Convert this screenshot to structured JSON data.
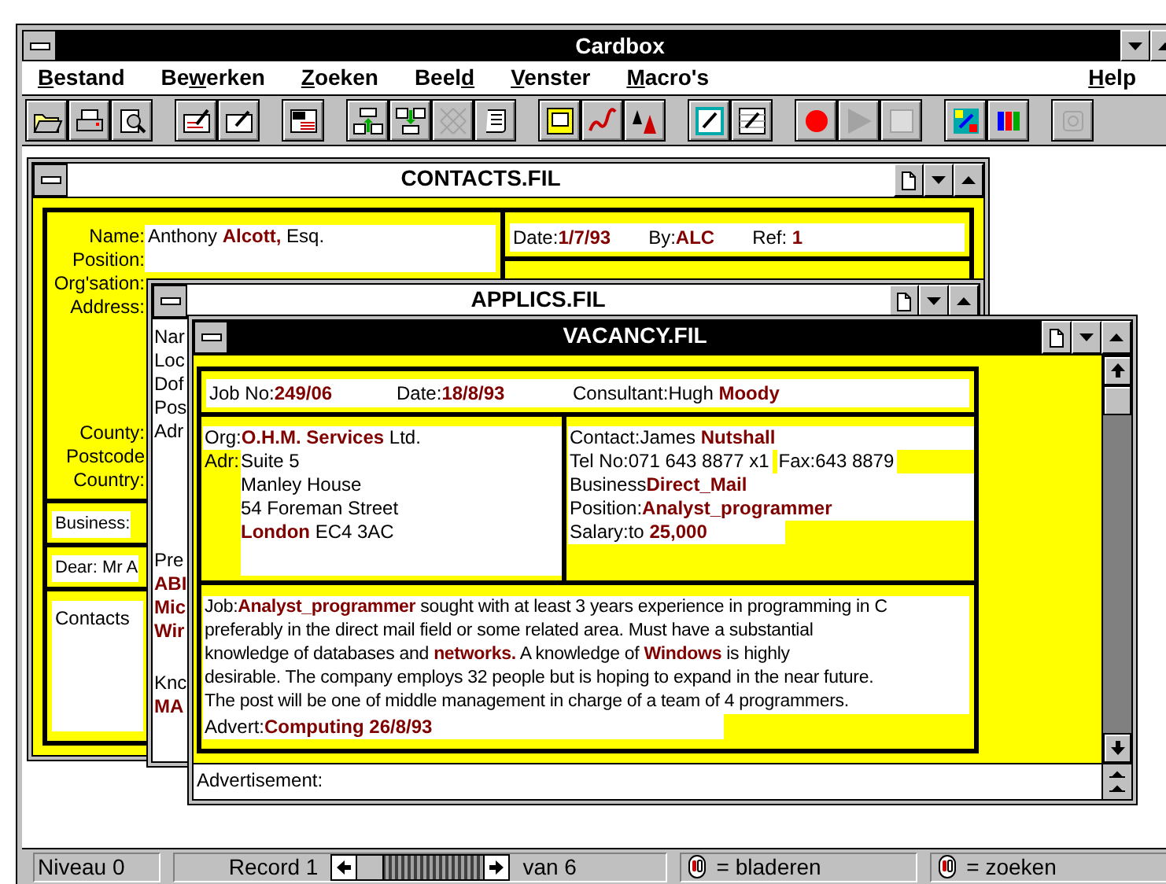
{
  "app": {
    "title": "Cardbox"
  },
  "menu": [
    {
      "key": "B",
      "post": "estand"
    },
    {
      "pre": "Be",
      "key": "w",
      "post": "erken"
    },
    {
      "key": "Z",
      "post": "oeken"
    },
    {
      "pre": "Beel",
      "key": "d"
    },
    {
      "key": "V",
      "post": "enster"
    },
    {
      "key": "M",
      "post": "acro's"
    }
  ],
  "help_menu": {
    "key": "H",
    "post": "elp"
  },
  "toolbar": [
    [
      {
        "kind": "open",
        "disabled": false
      },
      {
        "kind": "print",
        "disabled": false
      },
      {
        "kind": "preview",
        "disabled": false
      }
    ],
    [
      {
        "kind": "edit-card",
        "disabled": false
      },
      {
        "kind": "edit-pen",
        "disabled": false
      }
    ],
    [
      {
        "kind": "form",
        "disabled": false
      }
    ],
    [
      {
        "kind": "move-up",
        "disabled": false
      },
      {
        "kind": "move-down",
        "disabled": false
      },
      {
        "kind": "hatched",
        "disabled": true
      },
      {
        "kind": "scroll",
        "disabled": false
      }
    ],
    [
      {
        "kind": "layout",
        "disabled": false
      },
      {
        "kind": "spell",
        "disabled": false
      },
      {
        "kind": "font",
        "disabled": false
      }
    ],
    [
      {
        "kind": "edit-frame",
        "disabled": false
      },
      {
        "kind": "edit-grid",
        "disabled": false
      }
    ],
    [
      {
        "kind": "record",
        "disabled": false
      },
      {
        "kind": "play",
        "disabled": true
      },
      {
        "kind": "stop",
        "disabled": true
      }
    ],
    [
      {
        "kind": "colors",
        "disabled": false
      },
      {
        "kind": "palette",
        "disabled": false
      }
    ],
    [
      {
        "kind": "macro",
        "disabled": true
      }
    ]
  ],
  "contacts": {
    "title": "CONTACTS.FIL",
    "active": false,
    "labels_top": [
      "Name:",
      "Position:",
      "Org'sation:",
      "Address:"
    ],
    "labels_bottom": [
      "County:",
      "Postcode",
      "Country:"
    ],
    "name": "Anthony **Alcott,** Esq.",
    "date_row": [
      "Date:**1/7/93**",
      "By:**ALC**",
      "Ref: **1**"
    ],
    "business": "Business:",
    "dear": "Dear: Mr A",
    "notes": "Contacts"
  },
  "applics": {
    "title": "APPLICS.FIL",
    "active": false,
    "fragments": [
      [
        {
          "text": "Nar",
          "bold": false
        },
        {
          "text": "Loc",
          "bold": false
        },
        {
          "text": "Dof",
          "bold": false
        },
        {
          "text": "Pos",
          "bold": false
        },
        {
          "text": "Adr",
          "bold": false
        }
      ],
      [
        {
          "text": "Pre",
          "bold": false
        },
        {
          "text": "ABI",
          "bold": true
        },
        {
          "text": "Mic",
          "bold": true
        },
        {
          "text": "Wir",
          "bold": true
        }
      ],
      [
        {
          "text": "Knc",
          "bold": false
        },
        {
          "text": "MA",
          "bold": true
        }
      ]
    ]
  },
  "vacancy": {
    "title": "VACANCY.FIL",
    "active": true,
    "top_row": [
      "Job No:**249/06**",
      "Date:**18/8/93**",
      "Consultant:Hugh **Moody**"
    ],
    "org": "Org:**O.H.M. Services** Ltd.",
    "adr_label": "Adr:",
    "address": [
      "Suite 5",
      "Manley House",
      "54 Foreman Street",
      "**London** EC4 3AC"
    ],
    "contact_rows": [
      [
        "Contact:James **Nutshall**"
      ],
      [
        "Tel No:071 643 8877 x1",
        "Fax:643 8879"
      ],
      [
        "Business**Direct_Mail**"
      ],
      [
        "Position:**Analyst_programmer**"
      ],
      [
        "Salary:to **25,000**"
      ]
    ],
    "job": "Job:**Analyst_programmer** sought with at least 3 years experience in programming in C\npreferably in the direct mail field or some related area. Must have a substantial\nknowledge of databases and **networks.** A knowledge of **Windows** is highly\ndesirable. The company employs 32 people but is hoping to expand in the near future.\nThe post will be one of middle management in charge of a team of 4 programmers.",
    "advert": "Advert:**Computing 26/8/93**",
    "footer": "Advertisement:"
  },
  "status": {
    "level": "Niveau 0",
    "record": "Record 1",
    "of": "van 6",
    "browse": "= bladeren",
    "search": "= zoeken"
  }
}
